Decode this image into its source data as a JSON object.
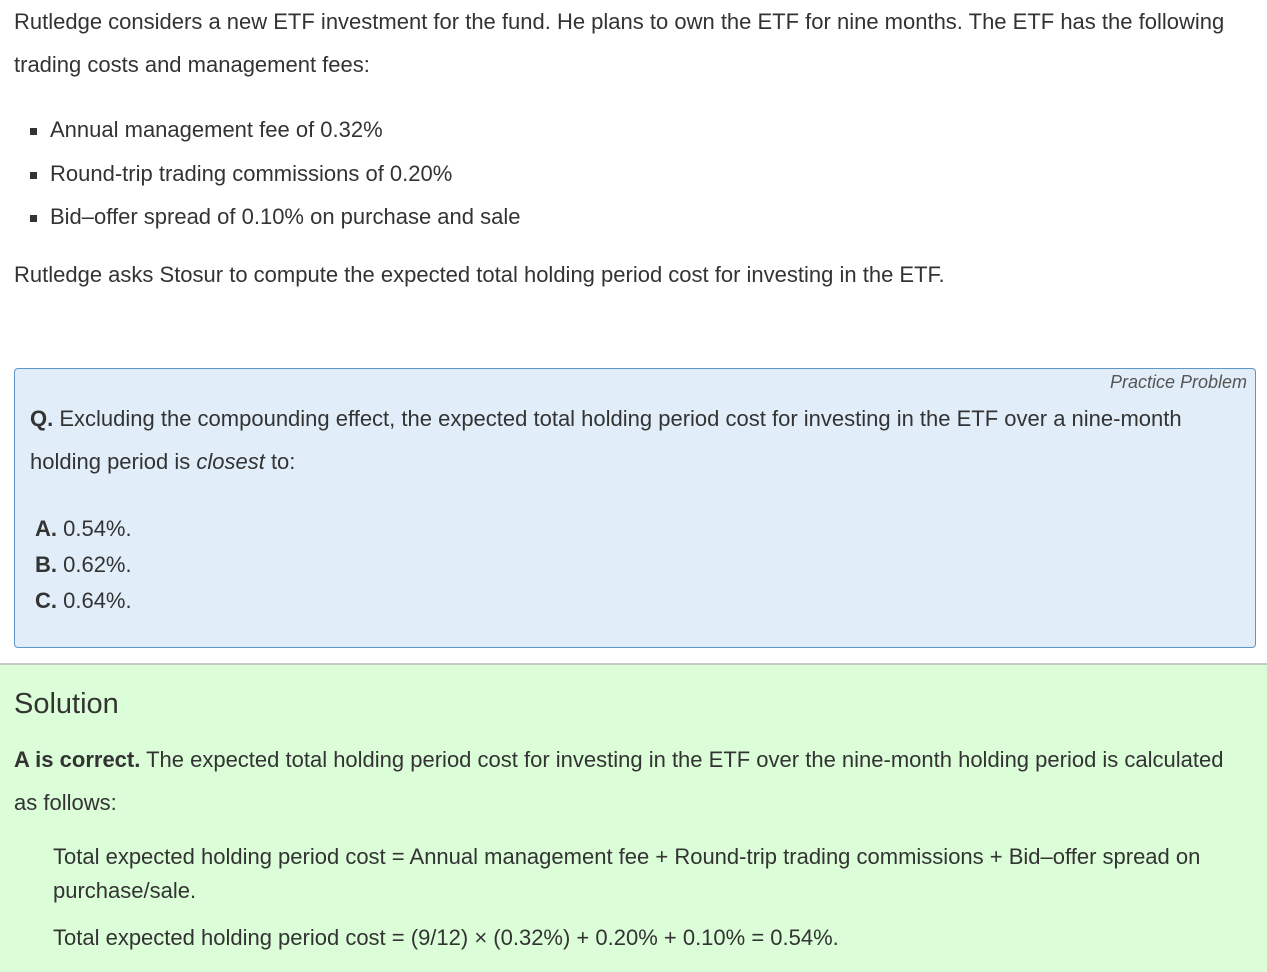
{
  "intro": {
    "paragraph": "Rutledge considers a new ETF investment for the fund. He plans to own the ETF for nine months. The ETF has the following trading costs and management fees:",
    "bullets": [
      "Annual management fee of 0.32%",
      "Round-trip trading commissions of 0.20%",
      "Bid–offer spread of 0.10% on purchase and sale"
    ],
    "closing": "Rutledge asks Stosur to compute the expected total holding period cost for investing in the ETF."
  },
  "practice": {
    "label": "Practice Problem",
    "question_prefix": "Q.",
    "question_text_before": " Excluding the compounding effect, the expected total holding period cost for investing in the ETF over a nine-month holding period is ",
    "question_emphasis": "closest",
    "question_text_after": " to:",
    "options": [
      {
        "letter": "A.",
        "text": " 0.54%."
      },
      {
        "letter": "B.",
        "text": " 0.62%."
      },
      {
        "letter": "C.",
        "text": " 0.64%."
      }
    ]
  },
  "solution": {
    "title": "Solution",
    "correct_label": "A is correct.",
    "explanation": " The expected total holding period cost for investing in the ETF over the nine-month holding period is calculated as follows:",
    "formula_general": "Total expected holding period cost = Annual management fee + Round-trip trading commissions + Bid–offer spread on purchase/sale.",
    "formula_numeric": "Total expected holding period cost = (9/12) × (0.32%) + 0.20% + 0.10% = 0.54%."
  },
  "colors": {
    "practice_background": "#e1eef9",
    "practice_border": "#5f95c8",
    "solution_background": "#dbfdd8",
    "text": "#333333"
  }
}
